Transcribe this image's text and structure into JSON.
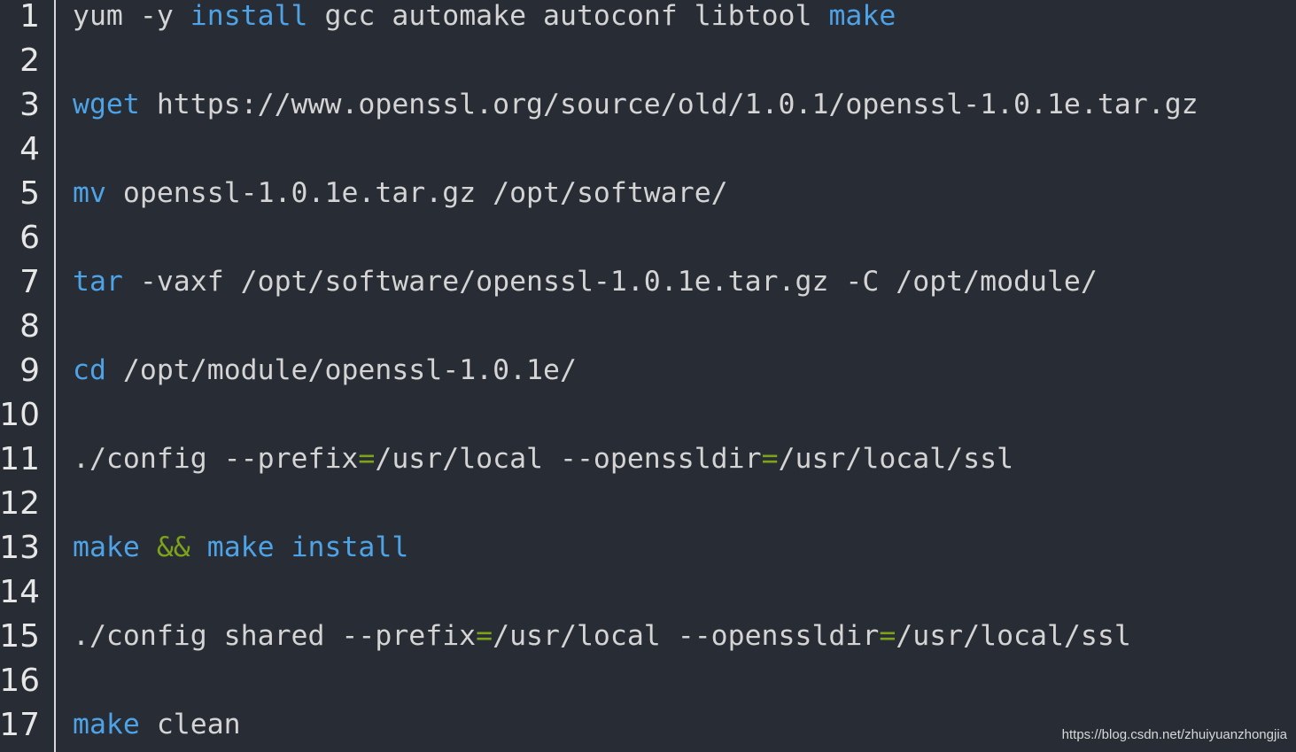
{
  "colors": {
    "background": "#282c34",
    "text": "#d4d4d4",
    "keyword": "#4ea2e6",
    "operator": "#7ea31a",
    "line_number": "#e6e6e6"
  },
  "lines": [
    {
      "n": "1",
      "tokens": [
        {
          "t": "yum -y ",
          "k": "txt"
        },
        {
          "t": "install",
          "k": "kw"
        },
        {
          "t": " gcc automake autoconf libtool ",
          "k": "txt"
        },
        {
          "t": "make",
          "k": "kw"
        }
      ]
    },
    {
      "n": "2",
      "tokens": []
    },
    {
      "n": "3",
      "tokens": [
        {
          "t": "wget",
          "k": "kw"
        },
        {
          "t": " https://www.openssl.org/source/old/1.0.1/openssl-1.0.1e.tar.gz",
          "k": "txt"
        }
      ]
    },
    {
      "n": "4",
      "tokens": []
    },
    {
      "n": "5",
      "tokens": [
        {
          "t": "mv",
          "k": "kw"
        },
        {
          "t": " openssl-1.0.1e.tar.gz /opt/software/",
          "k": "txt"
        }
      ]
    },
    {
      "n": "6",
      "tokens": []
    },
    {
      "n": "7",
      "tokens": [
        {
          "t": "tar",
          "k": "kw"
        },
        {
          "t": " -vaxf /opt/software/openssl-1.0.1e.tar.gz -C /opt/module/",
          "k": "txt"
        }
      ]
    },
    {
      "n": "8",
      "tokens": []
    },
    {
      "n": "9",
      "tokens": [
        {
          "t": "cd",
          "k": "kw"
        },
        {
          "t": " /opt/module/openssl-1.0.1e/",
          "k": "txt"
        }
      ]
    },
    {
      "n": "10",
      "tokens": []
    },
    {
      "n": "11",
      "tokens": [
        {
          "t": "./config --prefix",
          "k": "txt"
        },
        {
          "t": "=",
          "k": "op"
        },
        {
          "t": "/usr/local --openssldir",
          "k": "txt"
        },
        {
          "t": "=",
          "k": "op"
        },
        {
          "t": "/usr/local/ssl",
          "k": "txt"
        }
      ]
    },
    {
      "n": "12",
      "tokens": []
    },
    {
      "n": "13",
      "tokens": [
        {
          "t": "make",
          "k": "kw"
        },
        {
          "t": " ",
          "k": "txt"
        },
        {
          "t": "&&",
          "k": "op"
        },
        {
          "t": " ",
          "k": "txt"
        },
        {
          "t": "make",
          "k": "kw"
        },
        {
          "t": " ",
          "k": "txt"
        },
        {
          "t": "install",
          "k": "kw"
        }
      ]
    },
    {
      "n": "14",
      "tokens": []
    },
    {
      "n": "15",
      "tokens": [
        {
          "t": "./config shared --prefix",
          "k": "txt"
        },
        {
          "t": "=",
          "k": "op"
        },
        {
          "t": "/usr/local --openssldir",
          "k": "txt"
        },
        {
          "t": "=",
          "k": "op"
        },
        {
          "t": "/usr/local/ssl",
          "k": "txt"
        }
      ]
    },
    {
      "n": "16",
      "tokens": []
    },
    {
      "n": "17",
      "tokens": [
        {
          "t": "make",
          "k": "kw"
        },
        {
          "t": " clean",
          "k": "txt"
        }
      ]
    }
  ],
  "watermark": "https://blog.csdn.net/zhuiyuanzhongjia"
}
